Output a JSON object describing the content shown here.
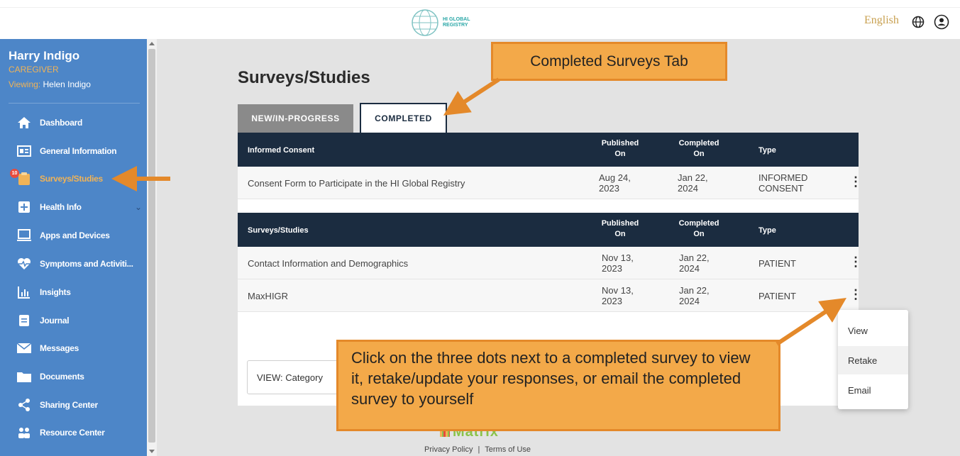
{
  "header": {
    "logo_line1": "HI GLOBAL",
    "logo_line2": "REGISTRY",
    "language": "English",
    "icons": [
      "globe-icon",
      "user-account-icon"
    ]
  },
  "sidebar": {
    "user_name": "Harry Indigo",
    "user_role": "CAREGIVER",
    "viewing_label": "Viewing:",
    "viewing_name": "Helen Indigo",
    "surveys_badge": "10",
    "items": [
      {
        "label": "Dashboard",
        "icon": "home-icon"
      },
      {
        "label": "General Information",
        "icon": "id-card-icon"
      },
      {
        "label": "Surveys/Studies",
        "icon": "clipboard-icon"
      },
      {
        "label": "Health Info",
        "icon": "plus-square-icon"
      },
      {
        "label": "Apps and Devices",
        "icon": "laptop-icon"
      },
      {
        "label": "Symptoms and Activiti...",
        "icon": "heartbeat-icon"
      },
      {
        "label": "Insights",
        "icon": "bar-chart-icon"
      },
      {
        "label": "Journal",
        "icon": "journal-icon"
      },
      {
        "label": "Messages",
        "icon": "envelope-icon"
      },
      {
        "label": "Documents",
        "icon": "folder-icon"
      },
      {
        "label": "Sharing Center",
        "icon": "share-icon"
      },
      {
        "label": "Resource Center",
        "icon": "people-icon"
      }
    ]
  },
  "main": {
    "title": "Surveys/Studies",
    "tabs": [
      {
        "label": "NEW/IN-PROGRESS",
        "active": false
      },
      {
        "label": "COMPLETED",
        "active": true
      }
    ],
    "tables": [
      {
        "columns": [
          "Informed Consent",
          "Published\nOn",
          "Completed\nOn",
          "Type"
        ],
        "rows": [
          {
            "name": "Consent Form to Participate in the HI Global Registry",
            "published": "Aug 24,\n2023",
            "completed": "Jan 22,\n2024",
            "type": "INFORMED\nCONSENT"
          }
        ]
      },
      {
        "columns": [
          "Surveys/Studies",
          "Published\nOn",
          "Completed\nOn",
          "Type"
        ],
        "rows": [
          {
            "name": "Contact Information and Demographics",
            "published": "Nov 13,\n2023",
            "completed": "Jan 22,\n2024",
            "type": "PATIENT"
          },
          {
            "name": "MaxHIGR",
            "published": "Nov 13,\n2023",
            "completed": "Jan 22,\n2024",
            "type": "PATIENT"
          }
        ]
      }
    ],
    "view_select": "VIEW: Category",
    "context_menu": [
      "View",
      "Retake",
      "Email"
    ]
  },
  "callouts": {
    "top": "Completed Surveys Tab",
    "bottom": "Click on the three dots next to a completed survey to view it, retake/update your responses, or email the completed survey to yourself",
    "color": "#f3a949",
    "arrow_color": "#e4892a"
  },
  "footer": {
    "logo": "Matrix",
    "privacy": "Privacy Policy",
    "separator": "|",
    "terms": "Terms of Use"
  },
  "colors": {
    "sidebar": "#4d86c8",
    "table_header": "#1b2c40",
    "accent": "#f0b357"
  }
}
